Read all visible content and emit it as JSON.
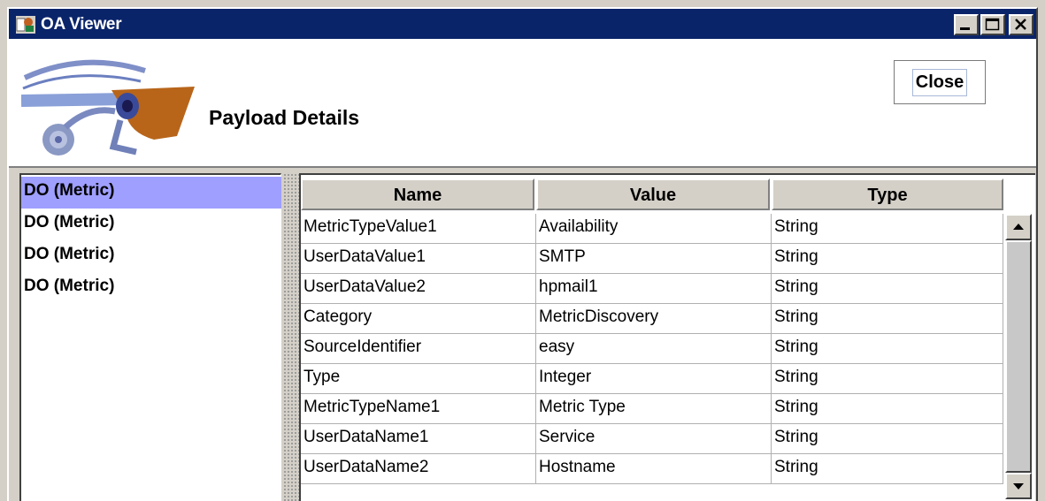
{
  "window": {
    "title": "OA Viewer",
    "icon": "oa-viewer-app-icon"
  },
  "header": {
    "title": "Payload Details",
    "close_label": "Close",
    "logo": "eye-of-horus-logo"
  },
  "list": {
    "items": [
      {
        "label": "DO (Metric)",
        "selected": true
      },
      {
        "label": "DO (Metric)",
        "selected": false
      },
      {
        "label": "DO (Metric)",
        "selected": false
      },
      {
        "label": "DO (Metric)",
        "selected": false
      }
    ]
  },
  "table": {
    "columns": [
      "Name",
      "Value",
      "Type"
    ],
    "rows": [
      [
        "MetricTypeValue1",
        "Availability",
        "String"
      ],
      [
        "UserDataValue1",
        "SMTP",
        "String"
      ],
      [
        "UserDataValue2",
        "hpmail1",
        "String"
      ],
      [
        "Category",
        "MetricDiscovery",
        "String"
      ],
      [
        "SourceIdentifier",
        "easy",
        "String"
      ],
      [
        "Type",
        "Integer",
        "String"
      ],
      [
        "MetricTypeName1",
        "Metric Type",
        "String"
      ],
      [
        "UserDataName1",
        "Service",
        "String"
      ],
      [
        "UserDataName2",
        "Hostname",
        "String"
      ]
    ]
  },
  "colors": {
    "titlebar": "#0a246a",
    "selection": "#9f9fff",
    "chrome": "#d4d0c8"
  }
}
